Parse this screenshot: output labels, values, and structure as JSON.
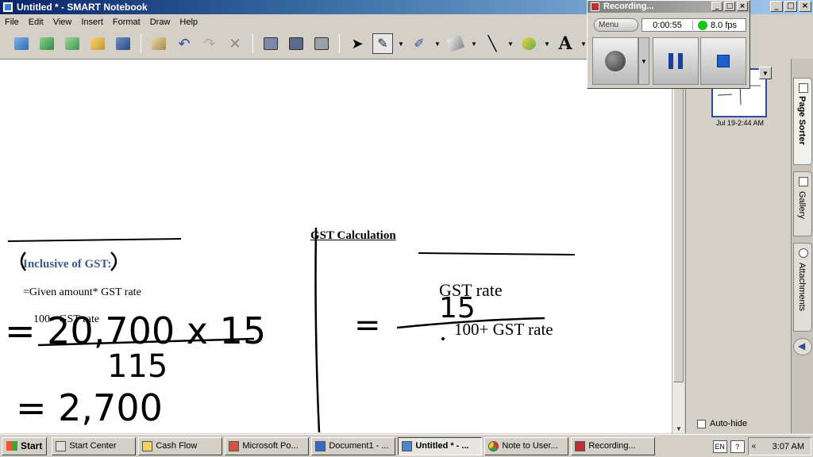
{
  "window": {
    "title": "Untitled * - SMART Notebook",
    "controls": [
      "_",
      "□",
      "×"
    ]
  },
  "menu": [
    "File",
    "Edit",
    "View",
    "Insert",
    "Format",
    "Draw",
    "Help"
  ],
  "toolbar": {
    "text_tool_glyph": "A"
  },
  "slide": {
    "title": "GST Calculation",
    "inclusive_heading": "Inclusive of GST:",
    "formula_numerator": "=Given amount* GST rate",
    "formula_denominator": "100+ GST rate",
    "rate_numerator": "GST rate",
    "rate_denominator": "100+ GST rate",
    "handwriting": {
      "line1": "= 20,700 x 15",
      "line1_den": "115",
      "line2": "= 2,700",
      "right_eq": "=",
      "right_num": "15"
    }
  },
  "page_sorter": {
    "thumbnail_date": "Jul 19-2:44 AM",
    "autohide_label": "Auto-hide"
  },
  "side_tabs": [
    "Page Sorter",
    "Gallery",
    "Attachments"
  ],
  "recorder": {
    "title": "Recording...",
    "menu_label": "Menu",
    "elapsed": "0:00:55",
    "fps": "8.0 fps",
    "status_color": "#19c419"
  },
  "taskbar": {
    "start_label": "Start",
    "tasks": [
      "Start Center",
      "Cash Flow",
      "Microsoft Po...",
      "Document1 - ...",
      "Untitled * - ...",
      "Note to User...",
      "Recording..."
    ],
    "active_task": "Untitled * - ...",
    "language": "EN",
    "clock": "3:07 AM"
  }
}
